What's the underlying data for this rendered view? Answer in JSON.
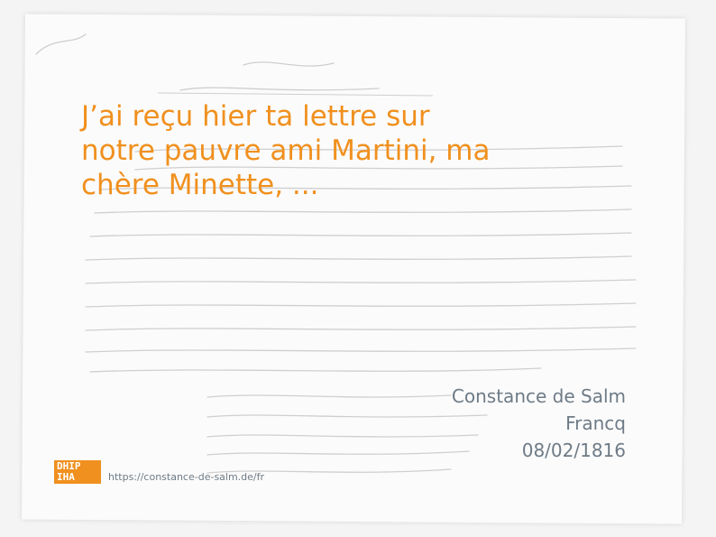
{
  "quote": {
    "text": " J’ai reçu hier ta lettre sur notre pauvre ami Martini, ma chère Minette, ..."
  },
  "letter_meta": {
    "author": "Constance de Salm",
    "recipient": "Francq",
    "date": "08/02/1816"
  },
  "logo": {
    "line1": "DHIP",
    "line2": "IHA"
  },
  "source_url": "https://constance-de-salm.de/fr",
  "colors": {
    "accent": "#f0901e",
    "meta_text": "#6e7b86",
    "ink": "#c9c9c9"
  }
}
